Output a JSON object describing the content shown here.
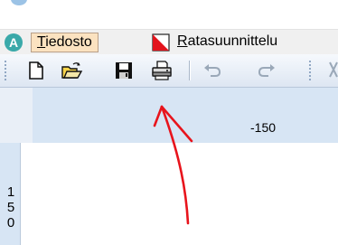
{
  "menubar": {
    "file_label": "Tiedosto",
    "file_mnemonic": "T",
    "file_rest": "iedosto",
    "rata_label": "Ratasuunnittelu",
    "rata_mnemonic": "R",
    "rata_rest": "atasuunnittelu"
  },
  "toolbar": {
    "buttons": [
      {
        "icon": "new-document-icon"
      },
      {
        "icon": "open-folder-icon"
      },
      {
        "icon": "save-icon"
      },
      {
        "icon": "print-icon"
      },
      {
        "icon": "undo-icon"
      },
      {
        "icon": "redo-icon"
      }
    ]
  },
  "ruler": {
    "horizontal_label": "-150",
    "vertical_label": "150"
  },
  "annotation": {
    "color": "#e8141c"
  }
}
